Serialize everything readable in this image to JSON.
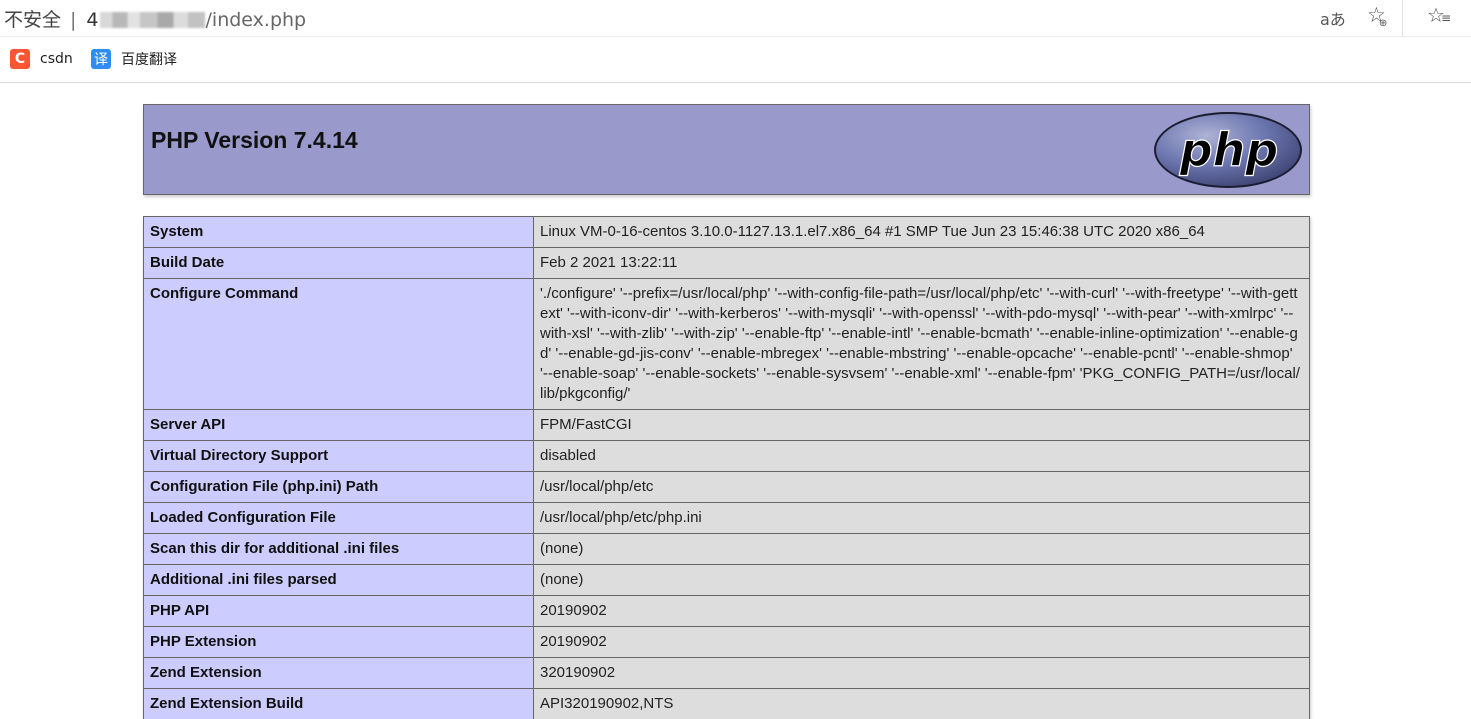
{
  "browser": {
    "security_label": "不安全",
    "separator": "|",
    "host_prefix": "4",
    "path": "/index.php",
    "read_aloud_icon": "aあ",
    "favorite_add_icon": "☆",
    "favorites_icon": "☆≡"
  },
  "bookmarks": [
    {
      "badge": "C",
      "label": "csdn",
      "color": "#fc5531"
    },
    {
      "badge": "译",
      "label": "百度翻译",
      "color": "#2f8cf3"
    }
  ],
  "phpinfo": {
    "title": "PHP Version 7.4.14",
    "logo_text": "php",
    "rows": [
      {
        "key": "System",
        "value": "Linux VM-0-16-centos 3.10.0-1127.13.1.el7.x86_64 #1 SMP Tue Jun 23 15:46:38 UTC 2020 x86_64"
      },
      {
        "key": "Build Date",
        "value": "Feb 2 2021 13:22:11"
      },
      {
        "key": "Configure Command",
        "value": "'./configure' '--prefix=/usr/local/php' '--with-config-file-path=/usr/local/php/etc' '--with-curl' '--with-freetype' '--with-gettext' '--with-iconv-dir' '--with-kerberos' '--with-mysqli' '--with-openssl' '--with-pdo-mysql' '--with-pear' '--with-xmlrpc' '--with-xsl' '--with-zlib' '--with-zip' '--enable-ftp' '--enable-intl' '--enable-bcmath' '--enable-inline-optimization' '--enable-gd' '--enable-gd-jis-conv' '--enable-mbregex' '--enable-mbstring' '--enable-opcache' '--enable-pcntl' '--enable-shmop' '--enable-soap' '--enable-sockets' '--enable-sysvsem' '--enable-xml' '--enable-fpm' 'PKG_CONFIG_PATH=/usr/local/lib/pkgconfig/'"
      },
      {
        "key": "Server API",
        "value": "FPM/FastCGI"
      },
      {
        "key": "Virtual Directory Support",
        "value": "disabled"
      },
      {
        "key": "Configuration File (php.ini) Path",
        "value": "/usr/local/php/etc"
      },
      {
        "key": "Loaded Configuration File",
        "value": "/usr/local/php/etc/php.ini"
      },
      {
        "key": "Scan this dir for additional .ini files",
        "value": "(none)"
      },
      {
        "key": "Additional .ini files parsed",
        "value": "(none)"
      },
      {
        "key": "PHP API",
        "value": "20190902"
      },
      {
        "key": "PHP Extension",
        "value": "20190902"
      },
      {
        "key": "Zend Extension",
        "value": "320190902"
      },
      {
        "key": "Zend Extension Build",
        "value": "API320190902,NTS"
      }
    ]
  },
  "colors": {
    "header_bg": "#9999cc",
    "key_bg": "#ccccff",
    "value_bg": "#dddddd",
    "logo_bg": "#6c77b2"
  }
}
